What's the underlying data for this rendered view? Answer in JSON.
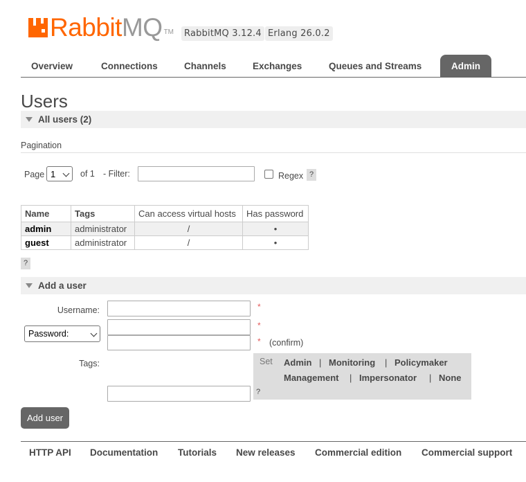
{
  "header": {
    "logo_rabbit": "Rabbit",
    "logo_mq": "MQ",
    "logo_tm": "TM",
    "rabbitmq_version": "RabbitMQ 3.12.4",
    "erlang_version": "Erlang 26.0.2",
    "brand_color": "#ff6600"
  },
  "tabs": [
    {
      "label": "Overview"
    },
    {
      "label": "Connections"
    },
    {
      "label": "Channels"
    },
    {
      "label": "Exchanges"
    },
    {
      "label": "Queues and Streams"
    },
    {
      "label": "Admin",
      "active": true
    }
  ],
  "page_title": "Users",
  "all_users": {
    "section_label": "All users (2)",
    "pagination_label": "Pagination",
    "page_label": "Page",
    "page_selected": "1",
    "of_label": "of 1",
    "filter_label": "- Filter:",
    "filter_value": "",
    "regex_label": "Regex",
    "regex_checked": false,
    "help": "?",
    "table": {
      "columns": [
        "Name",
        "Tags",
        "Can access virtual hosts",
        "Has password"
      ],
      "rows": [
        {
          "name": "admin",
          "tags": "administrator",
          "vhosts": "/",
          "has_password": "•"
        },
        {
          "name": "guest",
          "tags": "administrator",
          "vhosts": "/",
          "has_password": "•"
        }
      ]
    },
    "table_help": "?"
  },
  "add_user": {
    "section_label": "Add a user",
    "username_label": "Username:",
    "username_value": "",
    "password_mode": "Password:",
    "password_value": "",
    "confirm_value": "",
    "required_mark": "*",
    "confirm_label": "(confirm)",
    "tags_label": "Tags:",
    "tags_value": "",
    "set_label": "Set",
    "tag_options": [
      "Admin",
      "Monitoring",
      "Policymaker",
      "Management",
      "Impersonator",
      "None"
    ],
    "separator": "|",
    "tags_help": "?",
    "submit_label": "Add user"
  },
  "footer": {
    "links": [
      "HTTP API",
      "Documentation",
      "Tutorials",
      "New releases",
      "Commercial edition",
      "Commercial support"
    ]
  }
}
